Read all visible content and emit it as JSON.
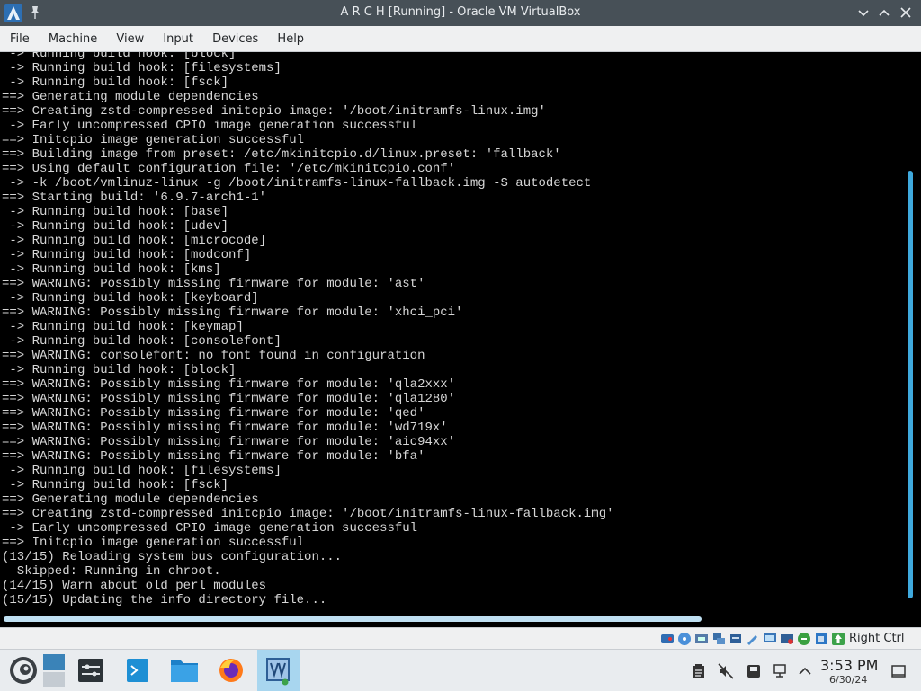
{
  "window": {
    "title": "A R C H [Running] - Oracle VM VirtualBox"
  },
  "menu": {
    "items": [
      "File",
      "Machine",
      "View",
      "Input",
      "Devices",
      "Help"
    ]
  },
  "console": {
    "lines": [
      " -> Running build hook: [block]",
      " -> Running build hook: [filesystems]",
      " -> Running build hook: [fsck]",
      "==> Generating module dependencies",
      "==> Creating zstd-compressed initcpio image: '/boot/initramfs-linux.img'",
      " -> Early uncompressed CPIO image generation successful",
      "==> Initcpio image generation successful",
      "==> Building image from preset: /etc/mkinitcpio.d/linux.preset: 'fallback'",
      "==> Using default configuration file: '/etc/mkinitcpio.conf'",
      " -> -k /boot/vmlinuz-linux -g /boot/initramfs-linux-fallback.img -S autodetect",
      "==> Starting build: '6.9.7-arch1-1'",
      " -> Running build hook: [base]",
      " -> Running build hook: [udev]",
      " -> Running build hook: [microcode]",
      " -> Running build hook: [modconf]",
      " -> Running build hook: [kms]",
      "==> WARNING: Possibly missing firmware for module: 'ast'",
      " -> Running build hook: [keyboard]",
      "==> WARNING: Possibly missing firmware for module: 'xhci_pci'",
      " -> Running build hook: [keymap]",
      " -> Running build hook: [consolefont]",
      "==> WARNING: consolefont: no font found in configuration",
      " -> Running build hook: [block]",
      "==> WARNING: Possibly missing firmware for module: 'qla2xxx'",
      "==> WARNING: Possibly missing firmware for module: 'qla1280'",
      "==> WARNING: Possibly missing firmware for module: 'qed'",
      "==> WARNING: Possibly missing firmware for module: 'wd719x'",
      "==> WARNING: Possibly missing firmware for module: 'aic94xx'",
      "==> WARNING: Possibly missing firmware for module: 'bfa'",
      " -> Running build hook: [filesystems]",
      " -> Running build hook: [fsck]",
      "==> Generating module dependencies",
      "==> Creating zstd-compressed initcpio image: '/boot/initramfs-linux-fallback.img'",
      " -> Early uncompressed CPIO image generation successful",
      "==> Initcpio image generation successful",
      "(13/15) Reloading system bus configuration...",
      "  Skipped: Running in chroot.",
      "(14/15) Warn about old perl modules",
      "(15/15) Updating the info directory file..."
    ]
  },
  "statusbar": {
    "host_key_label": "Right Ctrl",
    "icons": [
      "hard-disk-icon",
      "optical-drive-icon",
      "audio-icon",
      "network-icon",
      "usb-icon",
      "shared-folders-icon",
      "display-icon",
      "recording-icon",
      "mouse-integration-icon",
      "cpu-icon",
      "host-key-arrow-icon"
    ]
  },
  "taskbar": {
    "apps": [
      "application-launcher-icon",
      "settings-icon",
      "konsole-icon",
      "dolphin-icon",
      "firefox-icon",
      "virtualbox-icon"
    ],
    "tray": [
      "clipboard-icon",
      "volume-muted-icon",
      "storage-icon",
      "network-icon",
      "show-hidden-icon"
    ]
  },
  "clock": {
    "time": "3:53 PM",
    "date": "6/30/24"
  },
  "colors": {
    "titlebar": "#475057",
    "console_bg": "#000000",
    "console_text": "#d6d6d6",
    "scrollbar": "#3fa9dd",
    "taskbar": "#e9ecef",
    "active_task": "#a8d6ef"
  }
}
